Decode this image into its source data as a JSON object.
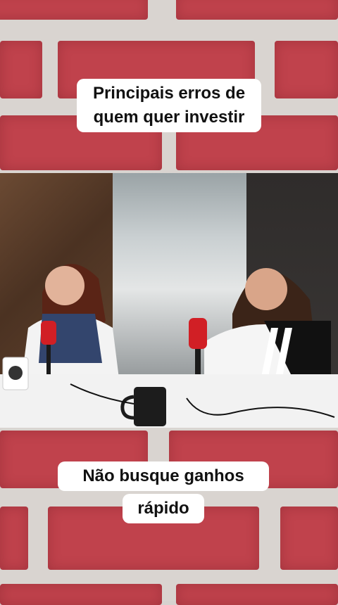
{
  "captions": {
    "top_line1": "Principais erros de",
    "top_line2": "quem quer investir",
    "bottom_line1": "Não busque ganhos",
    "bottom_line2": "rápido"
  },
  "colors": {
    "brick": "#c0424c",
    "mortar": "#d9d4d0",
    "caption_bg": "#ffffff"
  }
}
